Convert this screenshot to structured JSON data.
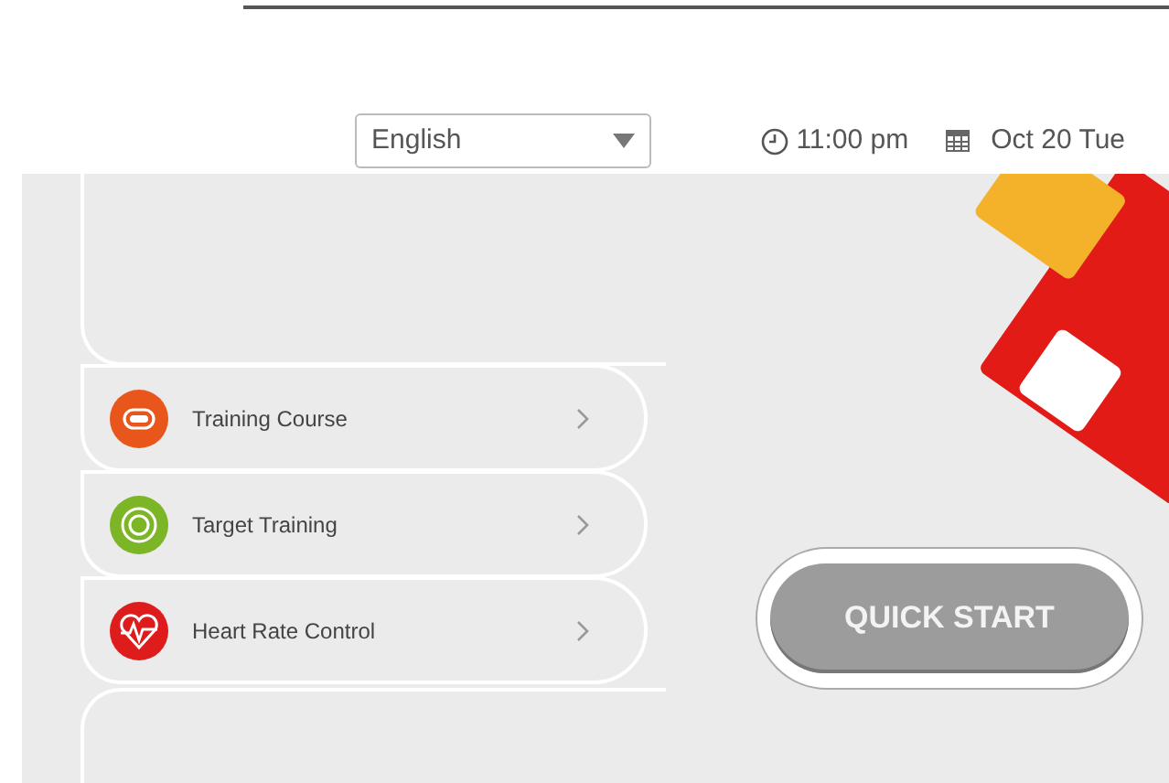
{
  "header": {
    "language": "English",
    "time": "11:00 pm",
    "date": "Oct 20 Tue"
  },
  "menu": [
    {
      "label": "Training Course",
      "color": "#e8561c",
      "kind": "track"
    },
    {
      "label": "Target Training",
      "color": "#7cb526",
      "kind": "target"
    },
    {
      "label": "Heart Rate Control",
      "color": "#de1c1c",
      "kind": "heart"
    }
  ],
  "quick_start": {
    "label": "QUICK START"
  }
}
